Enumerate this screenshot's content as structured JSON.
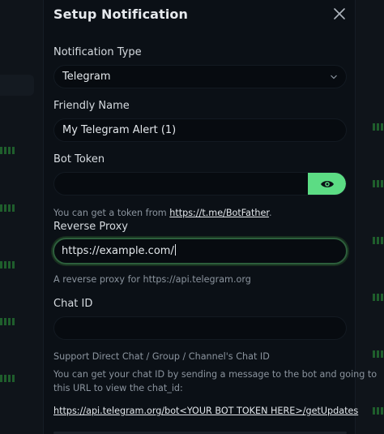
{
  "dialog": {
    "title": "Setup Notification"
  },
  "notification_type": {
    "label": "Notification Type",
    "value": "Telegram"
  },
  "friendly_name": {
    "label": "Friendly Name",
    "value": "My Telegram Alert (1)"
  },
  "bot_token": {
    "label": "Bot Token",
    "value": "",
    "hint_text": "You can get a token from ",
    "hint_link": "https://t.me/BotFather",
    "hint_suffix": "."
  },
  "reverse_proxy": {
    "label": "Reverse Proxy",
    "value": "https://example.com/",
    "hint": "A reverse proxy for https://api.telegram.org"
  },
  "chat_id": {
    "label": "Chat ID",
    "value": "",
    "hint1": "Support Direct Chat / Group / Channel's Chat ID",
    "hint2_line1": "You can get your chat ID by sending a message to the bot and going to",
    "hint2_line2": "this URL to view the chat_id:",
    "url": "https://api.telegram.org/bot<YOUR BOT TOKEN HERE>/getUpdates"
  },
  "icons": {
    "close": "close-icon",
    "chevron": "chevron-down-icon",
    "eye": "eye-icon"
  },
  "colors": {
    "accent": "#5cdc84",
    "focus_border": "#2d5f3c",
    "modal_bg": "#0b1016",
    "input_bg": "#070b10"
  }
}
